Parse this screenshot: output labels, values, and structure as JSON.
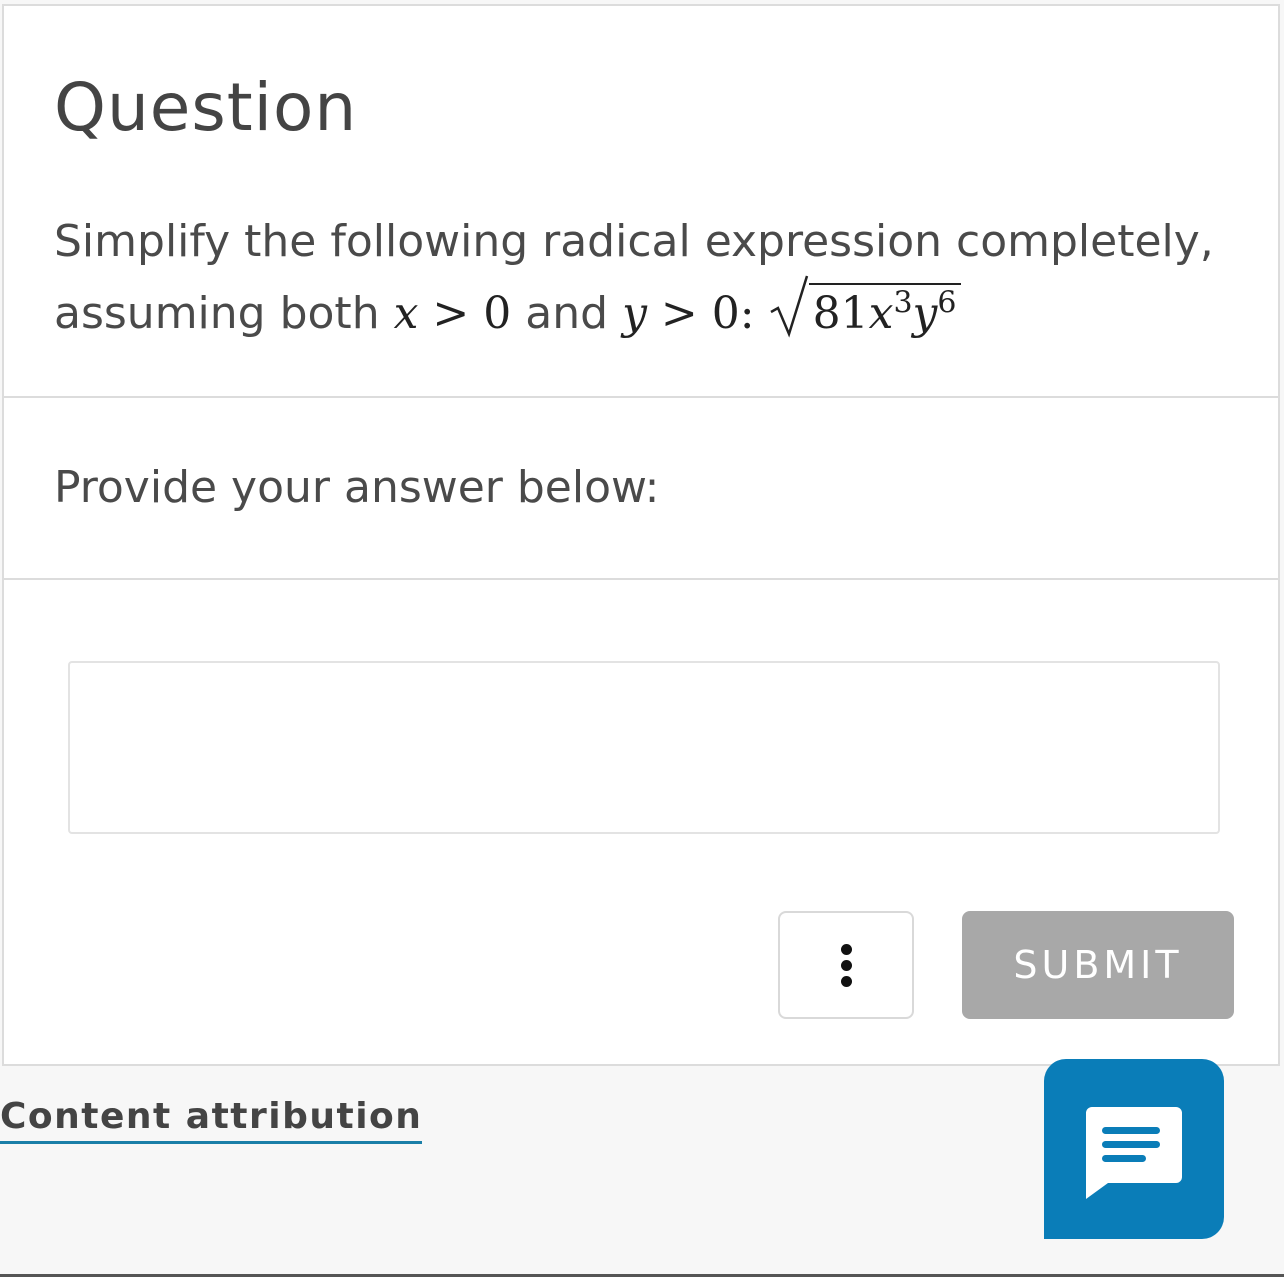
{
  "question": {
    "title": "Question",
    "prompt_text": "Simplify the following radical expression completely, assuming both",
    "cond_x_var": "x",
    "cond_gt": ">",
    "cond_zero": "0",
    "cond_and": "and",
    "cond_y_var": "y",
    "cond_colon": ":",
    "radicand_coeff": "81",
    "radicand_x": "x",
    "radicand_x_exp": "3",
    "radicand_y": "y",
    "radicand_y_exp": "6"
  },
  "answer_section": {
    "label": "Provide your answer below:",
    "input_value": ""
  },
  "actions": {
    "more_icon": "vertical-ellipsis-icon",
    "submit_label": "SUBMIT"
  },
  "footer": {
    "attribution_label": "Content attribution",
    "chat_icon": "chat-message-icon"
  },
  "colors": {
    "submit_disabled": "#a8a8a8",
    "chat_button": "#0a7db8",
    "link_underline": "#1a7fa8"
  }
}
